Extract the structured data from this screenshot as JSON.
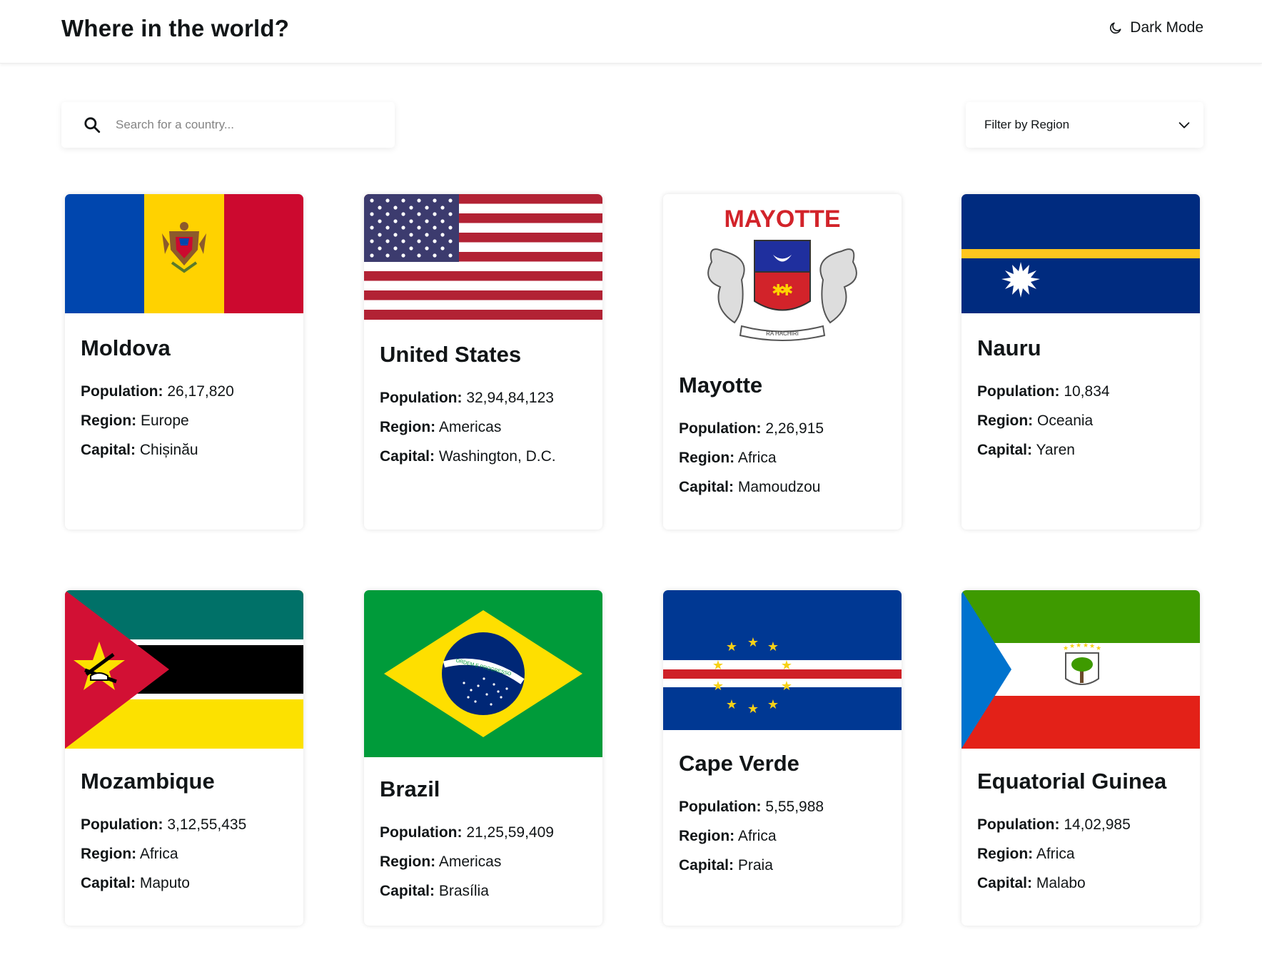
{
  "header": {
    "title": "Where in the world?",
    "mode_label": "Dark Mode"
  },
  "search": {
    "placeholder": "Search for a country..."
  },
  "filter": {
    "label": "Filter by Region"
  },
  "labels": {
    "population": "Population:",
    "region": "Region:",
    "capital": "Capital:"
  },
  "countries": [
    {
      "name": "Moldova",
      "population": "26,17,820",
      "region": "Europe",
      "capital": "Chișinău"
    },
    {
      "name": "United States",
      "population": "32,94,84,123",
      "region": "Americas",
      "capital": "Washington, D.C."
    },
    {
      "name": "Mayotte",
      "population": "2,26,915",
      "region": "Africa",
      "capital": "Mamoudzou",
      "flag_text": "MAYOTTE",
      "motto": "RA HACHIRI"
    },
    {
      "name": "Nauru",
      "population": "10,834",
      "region": "Oceania",
      "capital": "Yaren"
    },
    {
      "name": "Mozambique",
      "population": "3,12,55,435",
      "region": "Africa",
      "capital": "Maputo"
    },
    {
      "name": "Brazil",
      "population": "21,25,59,409",
      "region": "Americas",
      "capital": "Brasília",
      "motto": "ORDEM E PROGRESSO"
    },
    {
      "name": "Cape Verde",
      "population": "5,55,988",
      "region": "Africa",
      "capital": "Praia"
    },
    {
      "name": "Equatorial Guinea",
      "population": "14,02,985",
      "region": "Africa",
      "capital": "Malabo"
    }
  ]
}
